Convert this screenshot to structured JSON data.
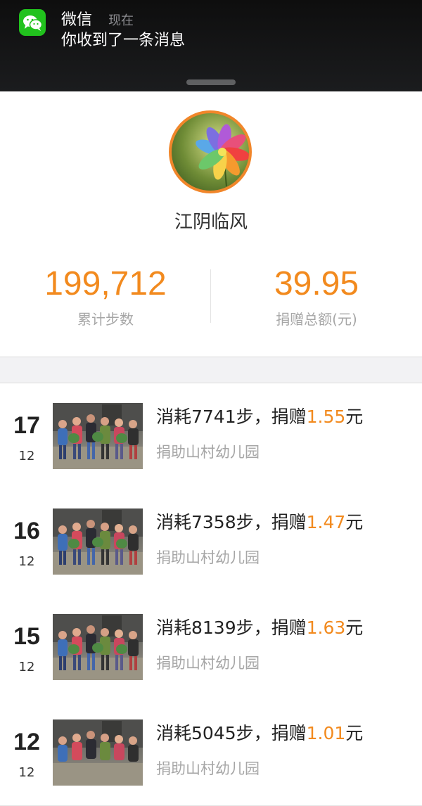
{
  "notification": {
    "app_name": "微信",
    "time": "现在",
    "message": "你收到了一条消息",
    "icon": "wechat-icon",
    "accent": "#21c21d"
  },
  "profile": {
    "name": "江阴临风",
    "avatar": "flower-avatar",
    "stats": [
      {
        "value": "199,712",
        "label": "累计步数"
      },
      {
        "value": "39.95",
        "label": "捐赠总额(元)"
      }
    ],
    "accent": "#f28a1e"
  },
  "records": [
    {
      "day": "17",
      "month": "12",
      "title_prefix": "消耗7741步，捐赠",
      "amount": "1.55",
      "unit": "元",
      "project": "捐助山村幼儿园"
    },
    {
      "day": "16",
      "month": "12",
      "title_prefix": "消耗7358步，捐赠",
      "amount": "1.47",
      "unit": "元",
      "project": "捐助山村幼儿园"
    },
    {
      "day": "15",
      "month": "12",
      "title_prefix": "消耗8139步，捐赠",
      "amount": "1.63",
      "unit": "元",
      "project": "捐助山村幼儿园"
    },
    {
      "day": "12",
      "month": "12",
      "title_prefix": "消耗5045步，捐赠",
      "amount": "1.01",
      "unit": "元",
      "project": "捐助山村幼儿园"
    }
  ]
}
